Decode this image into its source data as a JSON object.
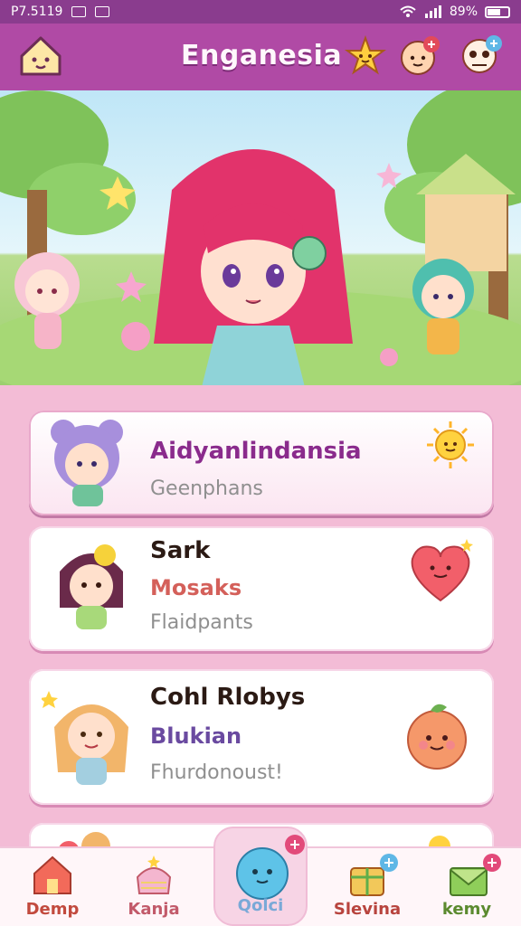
{
  "status_bar": {
    "time": "P7.5119",
    "battery": "89%"
  },
  "header": {
    "title": "Enganesia"
  },
  "hero": {
    "pages": 3,
    "active_page": 1
  },
  "cards": [
    {
      "name": "Aidyanlindansia",
      "subtitle": "",
      "meta": "Geenphans",
      "name_color": "#8a2b8c",
      "selected": true
    },
    {
      "name": "Sark",
      "subtitle": "Mosaks",
      "meta": "Flaidpants",
      "subtitle_color": "#d4605a"
    },
    {
      "name": "Cohl Rlobys",
      "subtitle": "Blukian",
      "meta": "Fhurdonoust!",
      "subtitle_color": "#6a4aa0"
    }
  ],
  "bottom_nav": [
    {
      "label": "Demp",
      "color": "#c24a3e"
    },
    {
      "label": "Kanja",
      "color": "#c25a6a"
    },
    {
      "label": "Qolci",
      "color": "#7aa9d7"
    },
    {
      "label": "Slevina",
      "color": "#b8443e"
    },
    {
      "label": "kemy",
      "color": "#5b8a2f"
    }
  ],
  "colors": {
    "header": "#b04aa5",
    "background": "#f3bcd6",
    "accent": "#8a2b8c"
  }
}
